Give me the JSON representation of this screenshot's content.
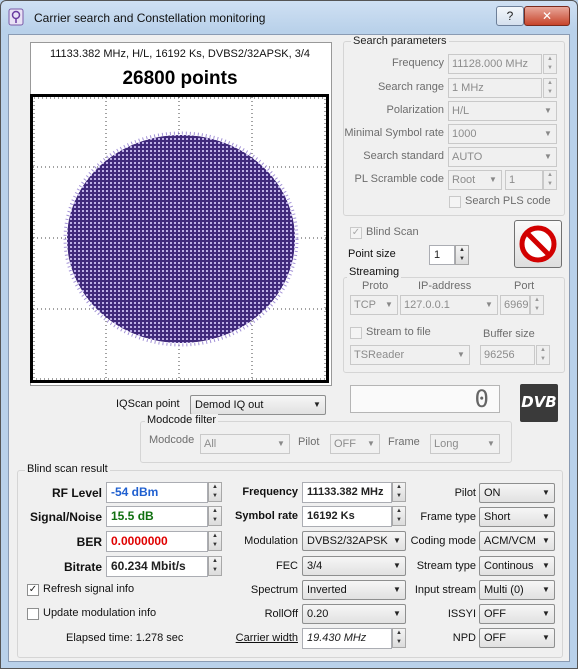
{
  "window": {
    "title": "Carrier search and Constellation monitoring",
    "help_label": "?",
    "close_label": "✕"
  },
  "constellation": {
    "info": "11133.382 MHz, H/L, 16192 Ks, DVBS2/32APSK, 3/4",
    "points_text": "26800 points"
  },
  "search_params": {
    "title": "Search parameters",
    "frequency_label": "Frequency",
    "frequency_value": "11128.000 MHz",
    "range_label": "Search range",
    "range_value": "1 MHz",
    "polarization_label": "Polarization",
    "polarization_value": "H/L",
    "min_sr_label": "Minimal Symbol rate",
    "min_sr_value": "1000",
    "standard_label": "Search standard",
    "standard_value": "AUTO",
    "pls_label": "PL Scramble code",
    "pls_mode": "Root",
    "pls_value": "1",
    "search_pls_label": "Search PLS code"
  },
  "blind_scan_label": "Blind Scan",
  "point_size": {
    "label": "Point size",
    "value": "1"
  },
  "streaming": {
    "title": "Streaming",
    "proto_label": "Proto",
    "ip_label": "IP-address",
    "port_label": "Port",
    "proto_value": "TCP",
    "ip_value": "127.0.0.1",
    "port_value": "6969",
    "stream_to_file_label": "Stream to file",
    "buffer_label": "Buffer size",
    "target_value": "TSReader",
    "buffer_value": "96256"
  },
  "counter_value": "0",
  "dvb_logo": "DVB",
  "iqscan": {
    "label": "IQScan point",
    "value": "Demod IQ out"
  },
  "modcode_filter": {
    "title": "Modcode filter",
    "modcode_label": "Modcode",
    "modcode_value": "All",
    "pilot_label": "Pilot",
    "pilot_value": "OFF",
    "frame_label": "Frame",
    "frame_value": "Long"
  },
  "result": {
    "title": "Blind scan result",
    "rf_label": "RF Level",
    "rf_value": "-54 dBm",
    "sn_label": "Signal/Noise",
    "sn_value": "15.5 dB",
    "ber_label": "BER",
    "ber_value": "0.0000000",
    "bitrate_label": "Bitrate",
    "bitrate_value": "60.234 Mbit/s",
    "refresh_label": "Refresh signal info",
    "update_label": "Update modulation info",
    "elapsed_label": "Elapsed time: 1.278 sec",
    "freq_label": "Frequency",
    "freq_value": "11133.382 MHz",
    "sr_label": "Symbol rate",
    "sr_value": "16192 Ks",
    "mod_label": "Modulation",
    "mod_value": "DVBS2/32APSK",
    "fec_label": "FEC",
    "fec_value": "3/4",
    "spectrum_label": "Spectrum",
    "spectrum_value": "Inverted",
    "rolloff_label": "RollOff",
    "rolloff_value": "0.20",
    "cw_label": "Carrier width",
    "cw_value": "19.430 MHz",
    "pilot_label": "Pilot",
    "pilot_value": "ON",
    "frame_label": "Frame type",
    "frame_value": "Short",
    "coding_label": "Coding mode",
    "coding_value": "ACM/VCM",
    "stream_label": "Stream type",
    "stream_value": "Continous",
    "input_label": "Input stream",
    "input_value": "Multi (0)",
    "issyi_label": "ISSYI",
    "issyi_value": "OFF",
    "npd_label": "NPD",
    "npd_value": "OFF"
  },
  "colors": {
    "rf": "#2060d0",
    "sn": "#107010",
    "ber": "#e00000",
    "points": "#3a1a8c"
  }
}
